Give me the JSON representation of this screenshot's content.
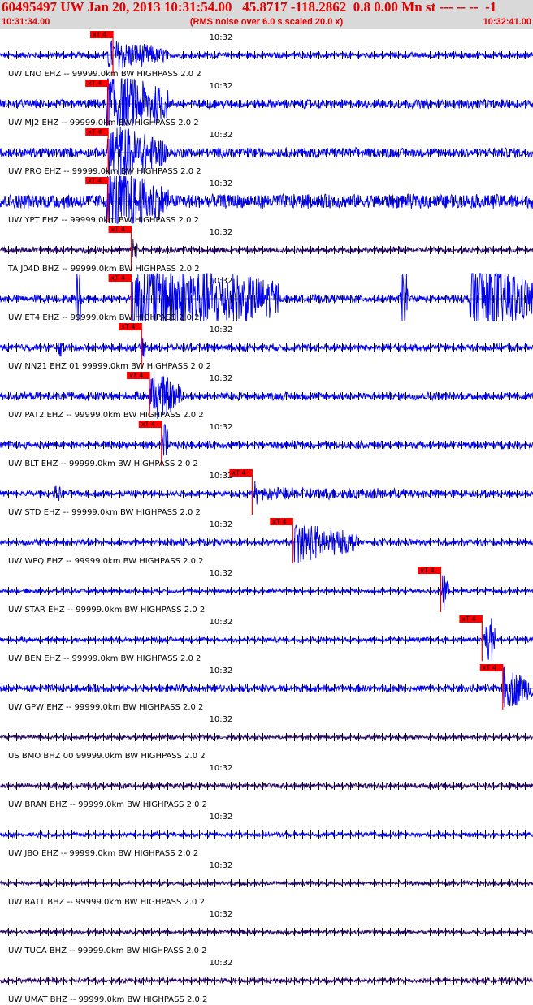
{
  "header": {
    "title": "60495497 UW Jan 20, 2013 10:31:54.00   45.8717 -118.2862  0.8 0.00 Mn st --- -- --  -1",
    "start_time": "10:31:34.00",
    "note": "(RMS noise over 6.0 s scaled 20.0 x)",
    "end_time": "10:32:41.00",
    "tick_label": "10:32",
    "pick_label": "xT 4"
  },
  "colors": {
    "trace": "#0000ee",
    "trace_dark": "#220066",
    "pick": "#ff0000",
    "header_bg": "#d9d9d9",
    "header_text": "#e00000"
  },
  "chart_data": {
    "type": "line",
    "title": "60495497 UW Jan 20, 2013 10:31:54.00   45.8717 -118.2862  0.8 0.00 Mn st --- -- --  -1",
    "x_range": [
      "10:31:34.00",
      "10:32:41.00"
    ],
    "x_range_seconds": [
      0,
      67
    ],
    "tick_interval_seconds": 1,
    "labeled_tick": "10:32",
    "grid": false,
    "series": [
      {
        "label": "UW LNO EHZ -- 99999.0km BW  HIGHPASS  2.0  2",
        "pick_seconds": 14.2,
        "color": "#0000ee",
        "event": [
          [
            13.5,
            21.0,
            0.75
          ]
        ],
        "extra": [],
        "noise": 0.12
      },
      {
        "label": "UW MJ2 EHZ -- 99999.0km BW  HIGHPASS  2.0  2",
        "pick_seconds": 13.6,
        "color": "#0000ee",
        "event": [
          [
            13.4,
            21.2,
            1.6
          ]
        ],
        "extra": [],
        "noise": 0.18
      },
      {
        "label": "UW PRO EHZ -- 99999.0km BW  HIGHPASS  2.0  2",
        "pick_seconds": 13.6,
        "color": "#0000ee",
        "event": [
          [
            13.5,
            21.0,
            1.4
          ]
        ],
        "extra": [],
        "noise": 0.2
      },
      {
        "label": "UW YPT EHZ -- 99999.0km BW  HIGHPASS  2.0  2",
        "pick_seconds": 13.6,
        "color": "#0000ee",
        "event": [
          [
            13.4,
            21.2,
            1.6
          ]
        ],
        "extra": [],
        "noise": 0.3
      },
      {
        "label": "TA J04D BHZ -- 99999.0km BW  HIGHPASS  2.0  2",
        "pick_seconds": 16.5,
        "color": "#220066",
        "event": [
          [
            16.5,
            17.6,
            0.8
          ]
        ],
        "extra": [],
        "noise": 0.12
      },
      {
        "label": "UW ET4 EHZ -- 99999.0km BW  HIGHPASS  2.0  2",
        "pick_seconds": 16.5,
        "color": "#0000ee",
        "event": [
          [
            16.5,
            35.0,
            2.0
          ]
        ],
        "extra": [
          [
            9.5,
            10.5,
            2.0
          ],
          [
            50.3,
            51.6,
            2.0
          ],
          [
            59.0,
            67.0,
            2.0
          ]
        ],
        "noise": 0.15
      },
      {
        "label": "UW NN21 EHZ 01 99999.0km BW  HIGHPASS  2.0  2",
        "pick_seconds": 17.8,
        "color": "#0000ee",
        "event": [
          [
            17.5,
            19.0,
            0.5
          ]
        ],
        "extra": [
          [
            7.3,
            8.0,
            0.55
          ]
        ],
        "noise": 0.14
      },
      {
        "label": "UW PAT2 EHZ -- 99999.0km BW  HIGHPASS  2.0  2",
        "pick_seconds": 18.8,
        "color": "#0000ee",
        "event": [
          [
            18.8,
            22.8,
            1.2
          ]
        ],
        "extra": [],
        "noise": 0.16
      },
      {
        "label": "UW BLT EHZ -- 99999.0km BW  HIGHPASS  2.0  2",
        "pick_seconds": 20.3,
        "color": "#0000ee",
        "event": [
          [
            20.3,
            21.5,
            1.1
          ]
        ],
        "extra": [],
        "noise": 0.15
      },
      {
        "label": "UW STD EHZ -- 99999.0km BW  HIGHPASS  2.0  2",
        "pick_seconds": 31.7,
        "color": "#0000ee",
        "event": [
          [
            31.7,
            32.8,
            0.6
          ]
        ],
        "extra": [
          [
            6.5,
            8.5,
            0.35
          ],
          [
            33.0,
            67.0,
            0.28
          ]
        ],
        "noise": 0.12
      },
      {
        "label": "UW WPQ EHZ -- 99999.0km BW  HIGHPASS  2.0  2",
        "pick_seconds": 36.8,
        "color": "#0000ee",
        "event": [
          [
            37.0,
            45.0,
            0.95
          ]
        ],
        "extra": [],
        "noise": 0.12
      },
      {
        "label": "UW STAR EHZ -- 99999.0km BW  HIGHPASS  2.0  2",
        "pick_seconds": 55.4,
        "color": "#0000ee",
        "event": [
          [
            55.4,
            56.8,
            0.9
          ]
        ],
        "extra": [],
        "noise": 0.08
      },
      {
        "label": "UW BEN EHZ -- 99999.0km BW  HIGHPASS  2.0  2",
        "pick_seconds": 60.6,
        "color": "#0000ee",
        "event": [
          [
            60.6,
            63.0,
            1.2
          ]
        ],
        "extra": [],
        "noise": 0.1
      },
      {
        "label": "UW GPW EHZ -- 99999.0km BW  HIGHPASS  2.0  2",
        "pick_seconds": 63.2,
        "color": "#0000ee",
        "event": [
          [
            63.2,
            67.0,
            1.0
          ]
        ],
        "extra": [],
        "noise": 0.14
      },
      {
        "label": "US BMO BHZ 00 99999.0km BW  HIGHPASS  2.0  2",
        "pick_seconds": null,
        "color": "#220066",
        "event": [],
        "extra": [],
        "noise": 0.08
      },
      {
        "label": "UW BRAN BHZ -- 99999.0km BW  HIGHPASS  2.0  2",
        "pick_seconds": null,
        "color": "#220066",
        "event": [],
        "extra": [],
        "noise": 0.1
      },
      {
        "label": "UW JBO EHZ -- 99999.0km BW  HIGHPASS  2.0  2",
        "pick_seconds": null,
        "color": "#0000ee",
        "event": [],
        "extra": [],
        "noise": 0.09
      },
      {
        "label": "UW RATT BHZ -- 99999.0km BW  HIGHPASS  2.0  2",
        "pick_seconds": null,
        "color": "#220066",
        "event": [],
        "extra": [],
        "noise": 0.08
      },
      {
        "label": "UW TUCA BHZ -- 99999.0km BW  HIGHPASS  2.0  2",
        "pick_seconds": null,
        "color": "#220066",
        "event": [],
        "extra": [],
        "noise": 0.08
      },
      {
        "label": "UW UMAT BHZ -- 99999.0km BW  HIGHPASS  2.0  2",
        "pick_seconds": null,
        "color": "#220066",
        "event": [],
        "extra": [],
        "noise": 0.1
      }
    ]
  }
}
